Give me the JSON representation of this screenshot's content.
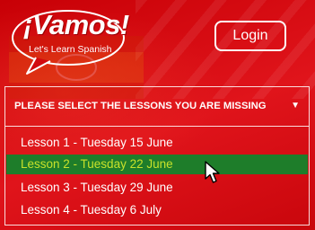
{
  "brand": {
    "logo_word": "¡Vamos!",
    "tagline": "Let's Learn Spanish"
  },
  "header": {
    "login_label": "Login"
  },
  "lesson_dropdown": {
    "title": "PLEASE SELECT THE LESSONS YOU ARE MISSING",
    "caret": "▼",
    "selected_index": 1,
    "options": [
      {
        "label": "Lesson 1 - Tuesday 15 June"
      },
      {
        "label": "Lesson 2 - Tuesday 22 June"
      },
      {
        "label": "Lesson 3 - Tuesday 29 June"
      },
      {
        "label": "Lesson 4 - Tuesday 6   July"
      }
    ]
  },
  "colors": {
    "background": "#d20a0f",
    "selected_bg": "#1e7d2a",
    "selected_text": "#c7e12a",
    "text": "#ffffff"
  },
  "icons": {
    "pointer": "mouse-pointer-icon"
  }
}
